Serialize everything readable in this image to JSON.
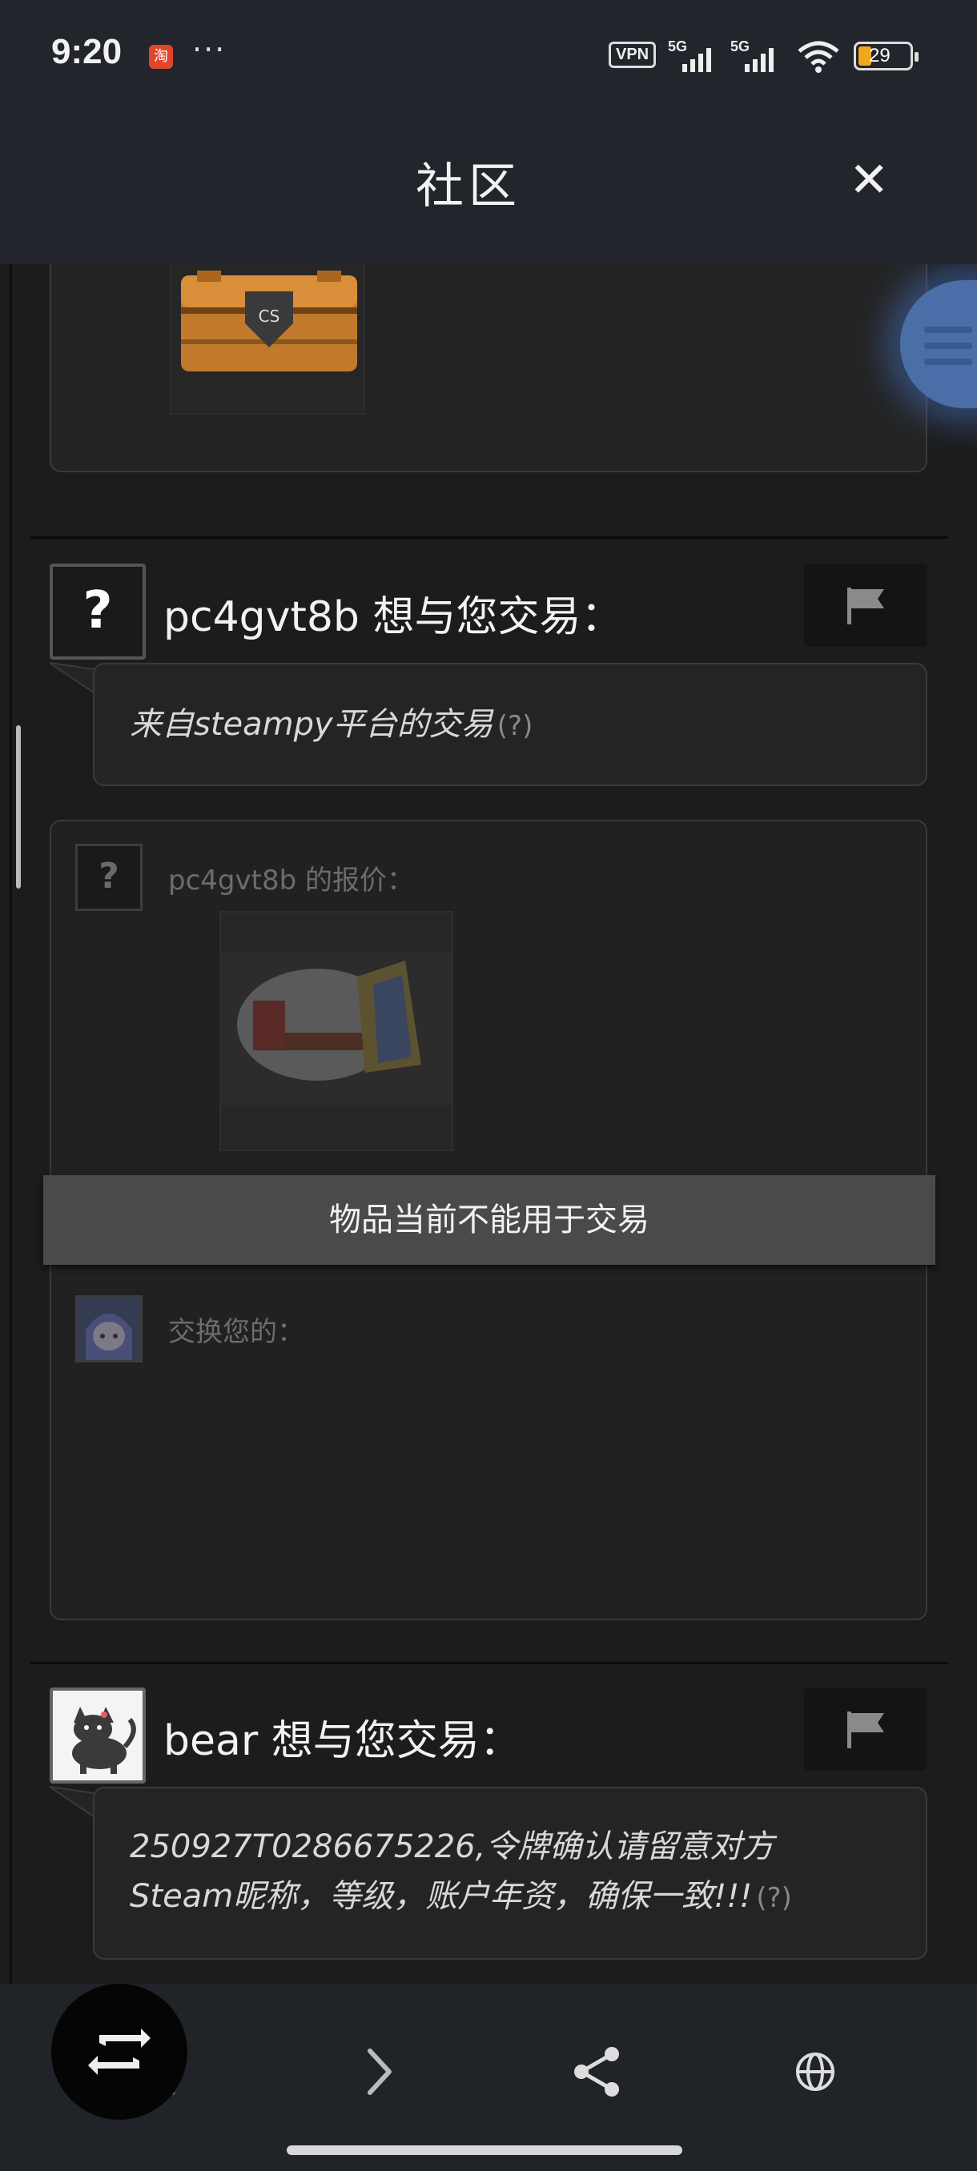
{
  "status_bar": {
    "time": "9:20",
    "app_badge": "淘",
    "more": "···",
    "vpn": "VPN",
    "signal_1": "5G",
    "signal_2": "5G",
    "battery": "29"
  },
  "header": {
    "title": "社区",
    "close_glyph": "✕"
  },
  "trades": [
    {
      "user": "pc4gvt8b",
      "heading": "pc4gvt8b 想与您交易：",
      "message": "来自steampy平台的交易",
      "hint": "(?)",
      "offer_label": "pc4gvt8b 的报价：",
      "unavailable_banner": "物品当前不能用于交易",
      "exchange_label": "交换您的："
    },
    {
      "user": "bear",
      "heading": "bear 想与您交易：",
      "message_line1": "250927T0286675226,令牌确认请留意对方",
      "message_line2": "Steam昵称，等级，账户年资，确保一致!!!",
      "hint": "(?)"
    }
  ],
  "avatar_placeholder": "?",
  "icons": {
    "flag": "flag-icon",
    "back": "chevron-left-icon",
    "forward": "chevron-right-icon",
    "share": "share-icon",
    "globe": "globe-icon",
    "swap": "swap-icon"
  },
  "colors": {
    "background": "#1c1c1c",
    "bar": "#22252b",
    "banner": "#4a4a4a",
    "accent_blue": "#4a6ea8"
  }
}
